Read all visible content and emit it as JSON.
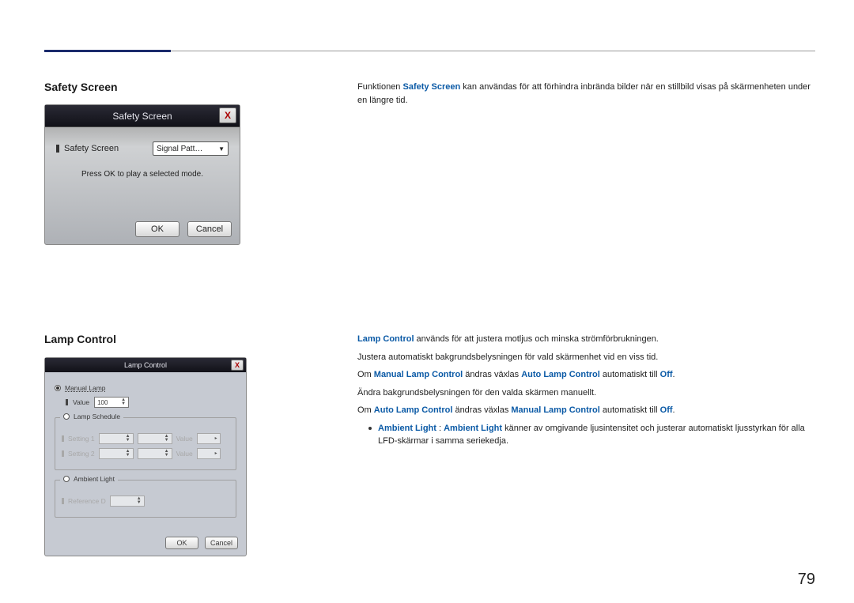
{
  "page_number": "79",
  "section1": {
    "heading": "Safety Screen",
    "desc_pre": "Funktionen ",
    "desc_strong": "Safety Screen",
    "desc_post": " kan användas för att förhindra inbrända bilder när en stillbild visas på skärmenheten under en längre tid.",
    "dialog": {
      "title": "Safety Screen",
      "close": "X",
      "label": "Safety Screen",
      "dropdown_value": "Signal Patt…",
      "message": "Press OK to play a selected mode.",
      "ok": "OK",
      "cancel": "Cancel"
    }
  },
  "section2": {
    "heading": "Lamp Control",
    "p1_strong": "Lamp Control",
    "p1_rest": " används för att justera motljus och minska strömförbrukningen.",
    "p2": "Justera automatiskt bakgrundsbelysningen för vald skärmenhet vid en viss tid.",
    "p3_pre": "Om ",
    "p3_s1": "Manual Lamp Control",
    "p3_mid": " ändras växlas ",
    "p3_s2": "Auto Lamp Control",
    "p3_mid2": " automatiskt till ",
    "p3_s3": "Off",
    "p3_end": ".",
    "p4": "Ändra bakgrundsbelysningen för den valda skärmen manuellt.",
    "p5_pre": "Om ",
    "p5_s1": "Auto Lamp Control",
    "p5_mid": " ändras växlas ",
    "p5_s2": "Manual Lamp Control",
    "p5_mid2": " automatiskt till ",
    "p5_s3": "Off",
    "p5_end": ".",
    "bullet_s1": "Ambient Light",
    "bullet_sep": " : ",
    "bullet_s2": "Ambient Light",
    "bullet_rest": " känner av omgivande ljusintensitet och justerar automatiskt ljusstyrkan för alla LFD-skärmar i samma seriekedja.",
    "dialog": {
      "title": "Lamp Control",
      "close": "X",
      "manual_lamp": "Manual Lamp",
      "value_label": "Value",
      "value": "100",
      "lamp_schedule": "Lamp Schedule",
      "setting1": "Setting 1",
      "setting2": "Setting 2",
      "sched_value_label": "Value",
      "ambient_light": "Ambient Light",
      "reference": "Reference D",
      "ok": "OK",
      "cancel": "Cancel"
    }
  }
}
